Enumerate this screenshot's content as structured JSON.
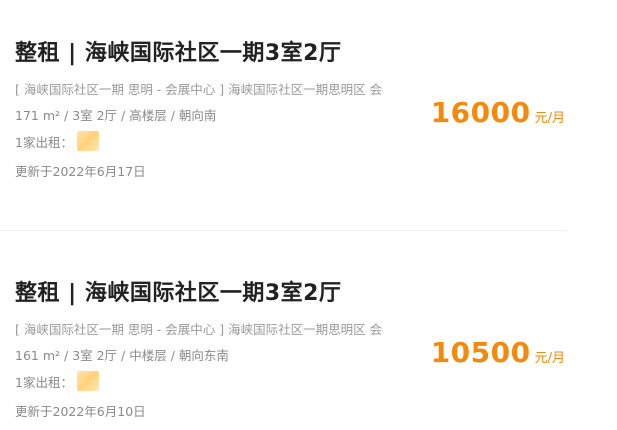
{
  "listings": [
    {
      "title": "整租 | 海峡国际社区一期3室2厅",
      "address": "[ 海峡国际社区一期 思明 - 会展中心 ] 海峡国际社区一期思明区 会",
      "attributes": "171 m² / 3室 2厅 / 高楼层 / 朝向南",
      "landlord_label": "1家出租：",
      "updated": "更新于2022年6月17日",
      "price": "16000",
      "price_unit": "元/月"
    },
    {
      "title": "整租 | 海峡国际社区一期3室2厅",
      "address": "[ 海峡国际社区一期 思明 - 会展中心 ] 海峡国际社区一期思明区 会",
      "attributes": "161 m² / 3室 2厅 / 中楼层 / 朝向东南",
      "landlord_label": "1家出租：",
      "updated": "更新于2022年6月10日",
      "price": "10500",
      "price_unit": "元/月"
    }
  ],
  "colors": {
    "price": "#f28a0c",
    "title": "#222222",
    "meta": "#8a8a8a"
  }
}
